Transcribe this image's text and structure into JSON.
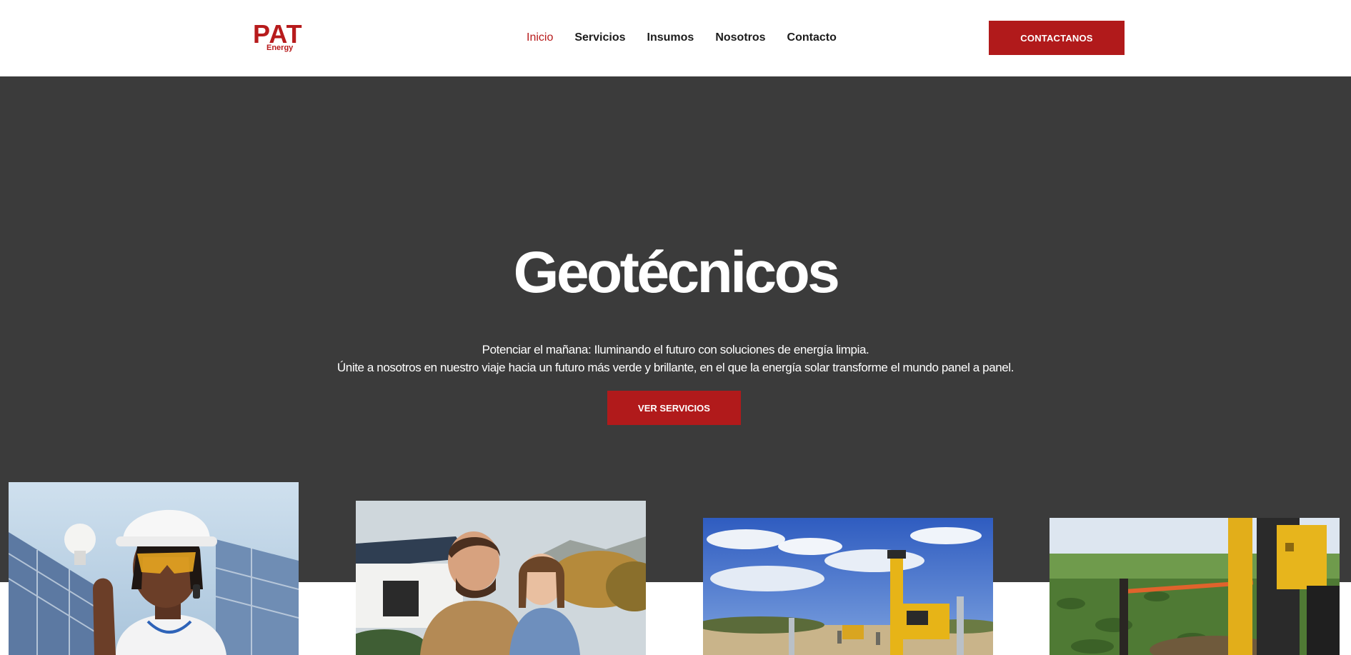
{
  "header": {
    "logo": {
      "main": "PAT",
      "sub": "Energy"
    },
    "nav": [
      {
        "label": "Inicio",
        "active": true
      },
      {
        "label": "Servicios",
        "active": false
      },
      {
        "label": "Insumos",
        "active": false
      },
      {
        "label": "Nosotros",
        "active": false
      },
      {
        "label": "Contacto",
        "active": false
      }
    ],
    "cta_label": "CONTACTANOS"
  },
  "hero": {
    "title": "Geotécnicos",
    "line1": "Potenciar el mañana: Iluminando el futuro con soluciones de energía limpia.",
    "line2": "Únite a nosotros en nuestro viaje hacia un futuro más verde y brillante, en el que la energía solar transforme el mundo panel a panel.",
    "cta_label": "VER SERVICIOS"
  },
  "colors": {
    "brand_red": "#b11a1b",
    "hero_bg": "#3b3b3b",
    "text_dark": "#1c1c1c"
  },
  "gallery": [
    {
      "name": "worker-with-lightbulb-photo"
    },
    {
      "name": "father-daughter-garden-photo"
    },
    {
      "name": "pile-driver-sky-photo"
    },
    {
      "name": "pile-driver-field-photo"
    }
  ]
}
